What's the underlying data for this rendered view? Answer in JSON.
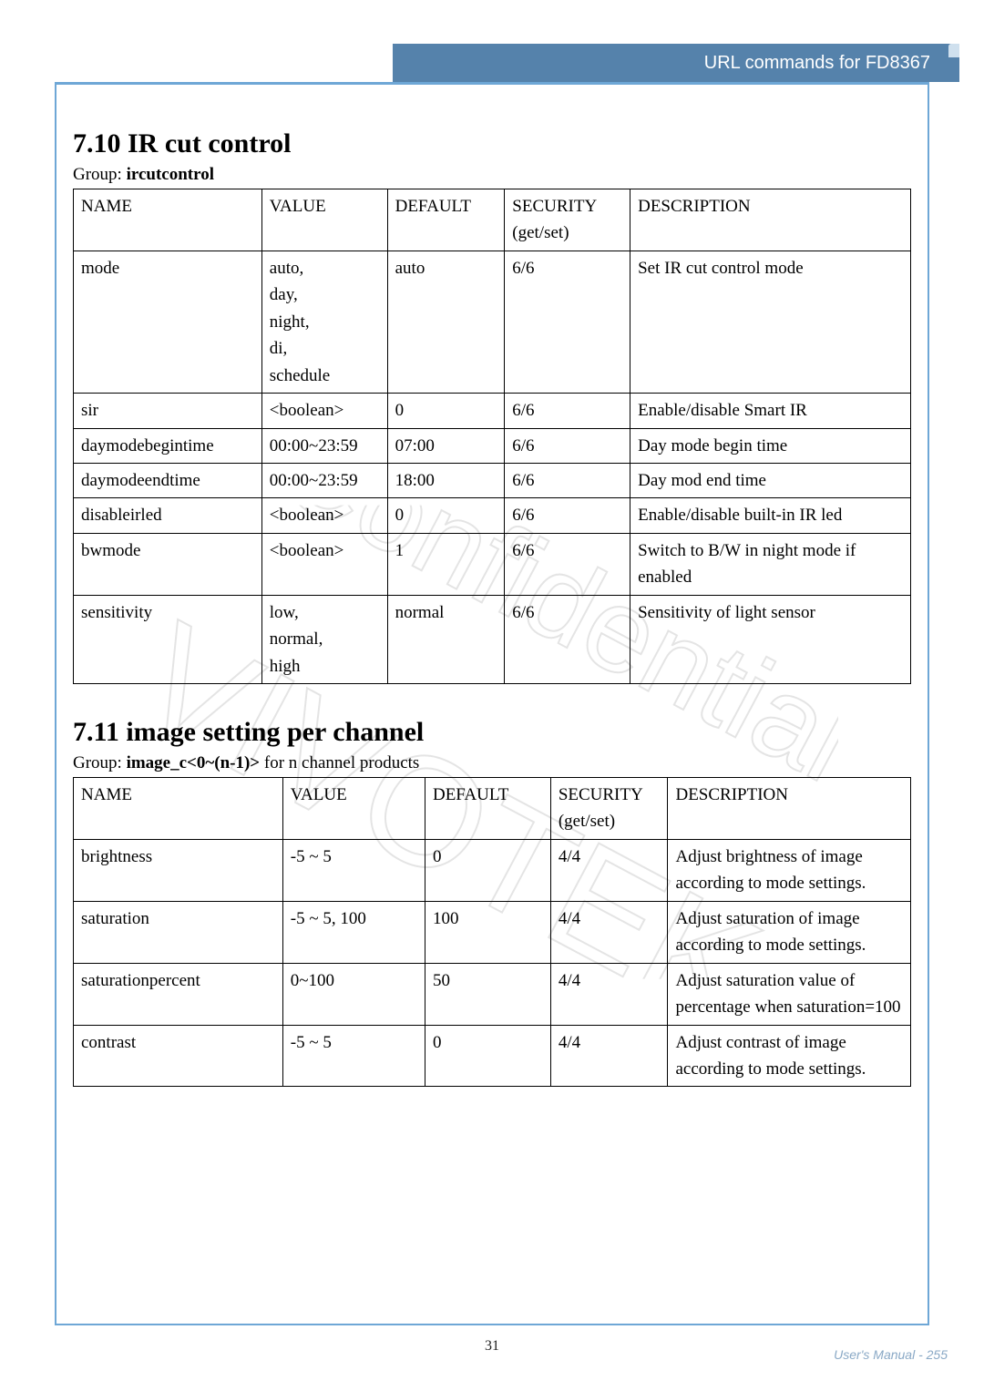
{
  "header": {
    "title": "URL commands for FD8367"
  },
  "section710": {
    "title": "7.10 IR cut control",
    "group_prefix": "Group: ",
    "group_name": "ircutcontrol",
    "headers": [
      "NAME",
      "VALUE",
      "DEFAULT",
      "SECURITY (get/set)",
      "DESCRIPTION"
    ],
    "rows": [
      {
        "name": "mode",
        "value": "auto,\nday,\nnight,\ndi,\nschedule",
        "default": "auto",
        "security": "6/6",
        "description": "Set IR cut control mode"
      },
      {
        "name": "sir",
        "value": "<boolean>",
        "default": "0",
        "security": "6/6",
        "description": "Enable/disable Smart IR"
      },
      {
        "name": "daymodebegintime",
        "value": "00:00~23:59",
        "default": "07:00",
        "security": "6/6",
        "description": "Day mode begin time"
      },
      {
        "name": "daymodeendtime",
        "value": "00:00~23:59",
        "default": "18:00",
        "security": "6/6",
        "description": "Day mod end time"
      },
      {
        "name": "disableirled",
        "value": "<boolean>",
        "default": "0",
        "security": "6/6",
        "description": "Enable/disable built-in IR led"
      },
      {
        "name": "bwmode",
        "value": "<boolean>",
        "default": "1",
        "security": "6/6",
        "description": "Switch to B/W in night mode if enabled"
      },
      {
        "name": "sensitivity",
        "value": "low,\nnormal,\nhigh",
        "default": "normal",
        "security": "6/6",
        "description": "Sensitivity of light sensor"
      }
    ]
  },
  "section711": {
    "title": "7.11 image setting per channel",
    "group_prefix": "Group: ",
    "group_name": "image_c<0~(n-1)>",
    "group_suffix": " for n channel products",
    "headers": [
      "NAME",
      "VALUE",
      "DEFAULT",
      "SECURITY (get/set)",
      "DESCRIPTION"
    ],
    "rows": [
      {
        "name": "brightness",
        "value": "-5 ~ 5",
        "default": "0",
        "security": "4/4",
        "description": "Adjust brightness of image according to mode settings."
      },
      {
        "name": "saturation",
        "value": "-5 ~ 5, 100",
        "default": "100",
        "security": "4/4",
        "description": "Adjust saturation of image according to mode settings."
      },
      {
        "name": "saturationpercent",
        "value": "0~100",
        "default": "50",
        "security": "4/4",
        "description": "Adjust saturation value of percentage when saturation=100"
      },
      {
        "name": "contrast",
        "value": "-5 ~ 5",
        "default": "0",
        "security": "4/4",
        "description": "Adjust contrast of image according to mode settings."
      }
    ]
  },
  "footer": {
    "center_page": "31",
    "right_label": "User's Manual - 255"
  }
}
